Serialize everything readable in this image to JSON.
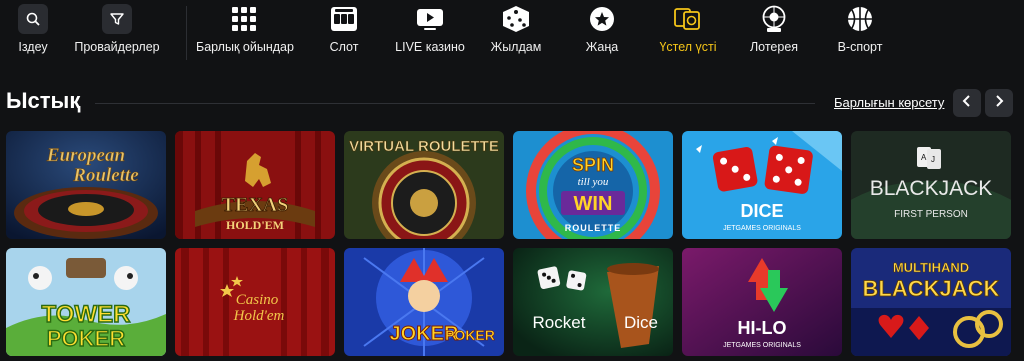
{
  "nav": {
    "items": [
      {
        "label": "Іздеу",
        "icon": "search-icon"
      },
      {
        "label": "Провайдерлер",
        "icon": "filter-icon"
      },
      {
        "label": "Барлық ойындар",
        "icon": "grid-icon"
      },
      {
        "label": "Слот",
        "icon": "slot-machine-icon"
      },
      {
        "label": "LIVE казино",
        "icon": "live-video-icon"
      },
      {
        "label": "Жылдам",
        "icon": "dice-icon"
      },
      {
        "label": "Жаңа",
        "icon": "star-icon"
      },
      {
        "label": "Үстел үсті",
        "icon": "table-games-icon",
        "active": true
      },
      {
        "label": "Лотерея",
        "icon": "lottery-ball-icon"
      },
      {
        "label": "В-спорт",
        "icon": "basketball-icon"
      }
    ],
    "active_color": "#f5c518"
  },
  "section": {
    "title": "Ыстық",
    "show_all": "Барлығын көрсету",
    "prev_icon": "chevron-left-icon",
    "next_icon": "chevron-right-icon"
  },
  "games": [
    {
      "name": "European Roulette",
      "art": [
        "European",
        "Roulette"
      ]
    },
    {
      "name": "Texas Hold'em",
      "art": [
        "TEXAS",
        "HOLD'EM"
      ]
    },
    {
      "name": "Virtual Roulette",
      "art": [
        "VIRTUAL ROULETTE"
      ]
    },
    {
      "name": "Spin till you Win Roulette",
      "art": [
        "SPIN",
        "till you",
        "WIN",
        "ROULETTE"
      ]
    },
    {
      "name": "Dice",
      "art": [
        "DICE",
        "JETGAMES ORIGINALS"
      ]
    },
    {
      "name": "Blackjack First Person",
      "art": [
        "BLACKJACK",
        "FIRST PERSON"
      ]
    },
    {
      "name": "Tower Poker",
      "art": [
        "TOWER",
        "POKER"
      ]
    },
    {
      "name": "Casino Hold'em",
      "art": [
        "Casino",
        "Hold'em"
      ]
    },
    {
      "name": "Joker Poker",
      "art": [
        "JOKER",
        "POKER"
      ]
    },
    {
      "name": "Rocket Dice",
      "art": [
        "Rocket",
        "Dice"
      ]
    },
    {
      "name": "Hi-Lo",
      "art": [
        "HI-LO",
        "JETGAMES ORIGINALS"
      ]
    },
    {
      "name": "Multihand Blackjack",
      "art": [
        "MULTIHAND",
        "BLACKJACK"
      ]
    }
  ]
}
